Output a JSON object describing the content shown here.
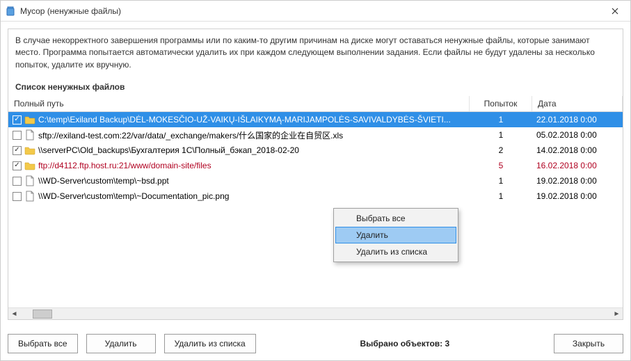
{
  "window": {
    "title": "Мусор (ненужные файлы)"
  },
  "info_text": "В случае некорректного завершения программы или по каким-то другим причинам на диске могут оставаться ненужные файлы, которые занимают место. Программа попытается автоматически удалить их при каждом следующем выполнении задания. Если файлы не будут удалены за несколько попыток, удалите их вручную.",
  "list_heading": "Список ненужных файлов",
  "columns": {
    "path": "Полный путь",
    "attempts": "Попыток",
    "date": "Дата"
  },
  "rows": [
    {
      "checked": true,
      "icon": "folder",
      "path": "C:\\temp\\Exiland Backup\\DĖL-MOKESČIO-UŽ-VAIKŲ-IŠLAIKYMĄ-MARIJAMPOLĖS-SAVIVALDYBĖS-ŠVIETI...",
      "attempts": "1",
      "date": "22.01.2018  0:00",
      "selected": true,
      "error": false
    },
    {
      "checked": false,
      "icon": "file",
      "path": "sftp://exiland-test.com:22/var/data/_exchange/makers/什么国家的企业在自贸区.xls",
      "attempts": "1",
      "date": "05.02.2018  0:00",
      "selected": false,
      "error": false
    },
    {
      "checked": true,
      "icon": "folder",
      "path": "\\\\serverPC\\Old_backups\\Бухгалтерия 1С\\Полный_бэкап_2018-02-20",
      "attempts": "2",
      "date": "14.02.2018  0:00",
      "selected": false,
      "error": false
    },
    {
      "checked": true,
      "icon": "folder",
      "path": "ftp://d4112.ftp.host.ru:21/www/domain-site/files",
      "attempts": "5",
      "date": "16.02.2018  0:00",
      "selected": false,
      "error": true
    },
    {
      "checked": false,
      "icon": "file",
      "path": "\\\\WD-Server\\custom\\temp\\~bsd.ppt",
      "attempts": "1",
      "date": "19.02.2018  0:00",
      "selected": false,
      "error": false
    },
    {
      "checked": false,
      "icon": "file",
      "path": "\\\\WD-Server\\custom\\temp\\~Documentation_pic.png",
      "attempts": "1",
      "date": "19.02.2018  0:00",
      "selected": false,
      "error": false
    }
  ],
  "context_menu": {
    "select_all": "Выбрать все",
    "delete": "Удалить",
    "remove_from_list": "Удалить из списка"
  },
  "footer": {
    "select_all": "Выбрать все",
    "delete": "Удалить",
    "remove_from_list": "Удалить из списка",
    "status": "Выбрано объектов: 3",
    "close": "Закрыть"
  }
}
